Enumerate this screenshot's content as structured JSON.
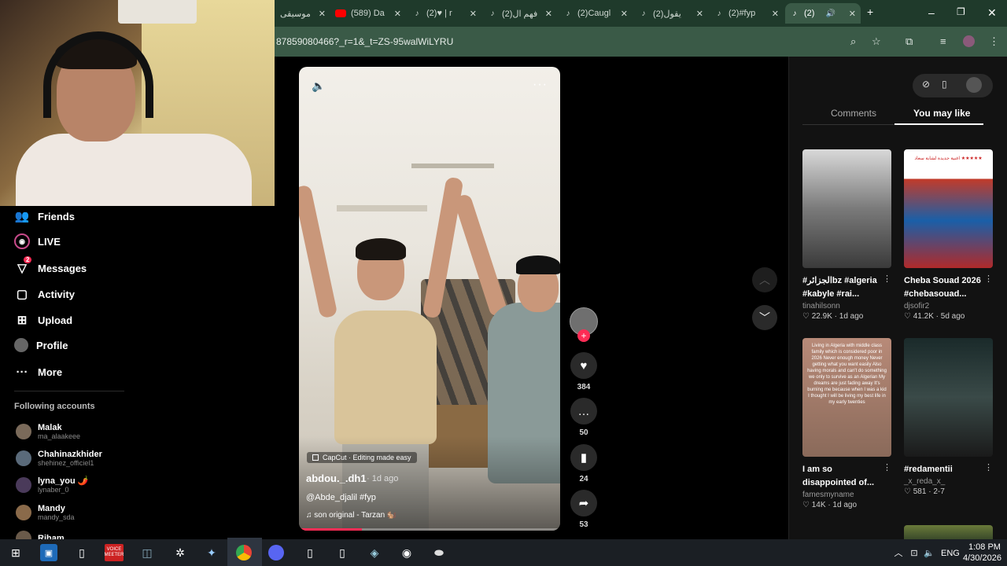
{
  "browser": {
    "tabs": [
      {
        "label": "موسيقى",
        "icon": "tiktok"
      },
      {
        "label": "(589) Da",
        "icon": "youtube"
      },
      {
        "label": "(2)♥ | r",
        "icon": "tiktok"
      },
      {
        "label": "(2)فهم ال",
        "icon": "tiktok"
      },
      {
        "label": "(2)Caugl",
        "icon": "tiktok"
      },
      {
        "label": "(2)يقول",
        "icon": "tiktok"
      },
      {
        "label": "(2)#fyp",
        "icon": "tiktok"
      },
      {
        "label": "(2)",
        "icon": "tiktok"
      }
    ],
    "url": "87859080466?_r=1&_t=ZS-95walWiLYRU"
  },
  "sidebar": {
    "items": [
      {
        "label": "Friends",
        "icon": "friends-icon"
      },
      {
        "label": "LIVE",
        "icon": "live-icon"
      },
      {
        "label": "Messages",
        "icon": "messages-icon",
        "badge": "2"
      },
      {
        "label": "Activity",
        "icon": "activity-icon"
      },
      {
        "label": "Upload",
        "icon": "upload-icon"
      },
      {
        "label": "Profile",
        "icon": "profile-icon"
      },
      {
        "label": "More",
        "icon": "more-icon"
      }
    ],
    "following_title": "Following accounts",
    "accounts": [
      {
        "name": "Malak",
        "handle": "ma_alaakeee"
      },
      {
        "name": "Chahinazkhider",
        "handle": "shehinez_officiel1"
      },
      {
        "name": "lyna_you 🌶️",
        "handle": "lynaber_0"
      },
      {
        "name": "Mandy",
        "handle": "mandy_sda"
      },
      {
        "name": "Riham",
        "handle": ""
      }
    ]
  },
  "video": {
    "capcut": "CapCut · Editing made easy",
    "author": "abdou._.dh1",
    "date": "· 1d ago",
    "caption": "@Abde_djalil #fyp",
    "music": "son original - Tarzan 🐿️",
    "progress": 0.24
  },
  "actions": {
    "likes": "384",
    "comments": "50",
    "saves": "24",
    "shares": "53"
  },
  "panel": {
    "tab_comments": "Comments",
    "tab_you_may_like": "You may like",
    "cards": [
      {
        "title": "#الجزائرbz #algeria #kabyle #rai...",
        "user": "tinahilsonn",
        "meta": "♡ 22.9K · 1d ago",
        "thumb_text": ""
      },
      {
        "title": "Cheba Souad 2026 #chebasouad...",
        "user": "djsofir2",
        "meta": "♡ 41.2K · 5d ago",
        "thumb_text": "اغنية جديدة لشابة سعاد ★★★★★"
      },
      {
        "title": "I am so disappointed of...",
        "user": "famesmyname",
        "meta": "♡ 14K · 1d ago",
        "thumb_text": "Living in Algeria with middle class family which is considered poor in 2026 Never enough money Never getting what you want easily Also having morals and can't do something we only to survive as an Algerian My dreams are just fading away It's burning me because when I was a kid I thought I will be living my best life in my early twenties"
      },
      {
        "title": "#redamentii",
        "user": "_x_reda_x_",
        "meta": "♡ 581 · 2-7",
        "thumb_text": ""
      }
    ]
  },
  "taskbar": {
    "lang": "ENG",
    "time": "1:08 PM",
    "date": "4/30/2026",
    "voicemeeter": "VOICE MEETER"
  },
  "colors": {
    "accent": "#fe2c55",
    "chrome_bg": "#1f3a2b",
    "address_bg": "#3a5a47"
  }
}
